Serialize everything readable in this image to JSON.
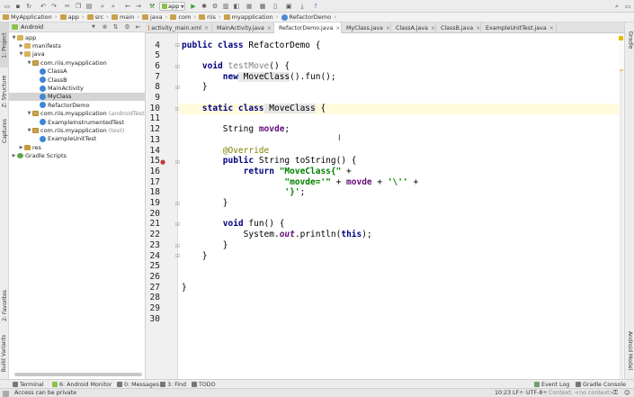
{
  "toolbar": {
    "run_config": "app",
    "icons": [
      "open-icon",
      "save-icon",
      "sync-icon",
      "undo-icon",
      "redo-icon",
      "cut-icon",
      "copy-icon",
      "paste-icon",
      "find-icon",
      "replace-icon",
      "back-icon",
      "forward-icon",
      "build-icon",
      "run-icon",
      "debug-icon",
      "attach-icon",
      "stop-icon",
      "sdk-icon",
      "avd-icon",
      "help-icon",
      "search-icon"
    ]
  },
  "breadcrumb": [
    "MyApplication",
    "app",
    "src",
    "main",
    "java",
    "com",
    "riis",
    "myapplication",
    "RefactorDemo"
  ],
  "left_tabs": {
    "project": "1: Project",
    "structure": "Z: Structure",
    "captures": "Captures",
    "favorites": "2: Favorites",
    "build_variants": "Build Variants"
  },
  "right_tabs": {
    "gradle": "Gradle",
    "android_model": "Android Model"
  },
  "project": {
    "view": "Android",
    "tree": [
      {
        "label": "app",
        "muted": ""
      },
      {
        "label": "manifests",
        "muted": ""
      },
      {
        "label": "java",
        "muted": ""
      },
      {
        "label": "com.riis.myapplication",
        "muted": ""
      },
      {
        "label": "ClassA",
        "muted": ""
      },
      {
        "label": "ClassB",
        "muted": ""
      },
      {
        "label": "MainActivity",
        "muted": ""
      },
      {
        "label": "MyClass",
        "muted": ""
      },
      {
        "label": "RefactorDemo",
        "muted": ""
      },
      {
        "label": "com.riis.myapplication",
        "muted": "(androidTest"
      },
      {
        "label": "ExampleInstrumentedTest",
        "muted": ""
      },
      {
        "label": "com.riis.myapplication",
        "muted": "(test)"
      },
      {
        "label": "ExampleUnitTest",
        "muted": ""
      },
      {
        "label": "res",
        "muted": ""
      },
      {
        "label": "Gradle Scripts",
        "muted": ""
      }
    ]
  },
  "tabs": [
    "activity_main.xml",
    "MainActivity.java",
    "RefactorDemo.java",
    "MyClass.java",
    "ClassA.java",
    "ClassB.java",
    "ExampleUnitTest.java"
  ],
  "line_numbers": [
    "4",
    "5",
    "6",
    "7",
    "8",
    "9",
    "10",
    "11",
    "12",
    "13",
    "14",
    "15",
    "16",
    "17",
    "18",
    "19",
    "20",
    "21",
    "22",
    "23",
    "24",
    "25",
    "26",
    "27",
    "28",
    "29",
    "30"
  ],
  "code": {
    "l4a": "public class",
    "l4b": " RefactorDemo {",
    "l6a": "void",
    "l6b": " testMove",
    "l6c": "() {",
    "l7a": "new",
    "l7b": " MoveClass",
    "l7c": "().fun();",
    "l8": "}",
    "l10a": "static class",
    "l10b": " MoveClass",
    "l10c": " {",
    "l12a": "String ",
    "l12b": "movde",
    "l12c": ";",
    "l14": "@Override",
    "l15a": "public",
    "l15b": " String toString() {",
    "l16a": "return",
    "l16b": " \"MoveClass{\"",
    "l16c": " +",
    "l17a": "\"movde='\"",
    "l17b": " + ",
    "l17c": "movde",
    "l17d": " + ",
    "l17e": "'\\''",
    "l17f": " +",
    "l18a": "'}'",
    "l18b": ";",
    "l19": "}",
    "l21a": "void",
    "l21b": " fun() {",
    "l22a": "System.",
    "l22b": "out",
    "l22c": ".println(",
    "l22d": "this",
    "l22e": ");",
    "l23": "}",
    "l24": "}",
    "l27": "}"
  },
  "bottom_tabs": [
    "Terminal",
    "6: Android Monitor",
    "0: Messages",
    "3: Find",
    "TODO",
    "Event Log",
    "Gradle Console"
  ],
  "status": {
    "message": "Access can be private",
    "position": "10:23",
    "line_sep": "LF÷",
    "encoding": "UTF-8÷",
    "context": "Context: <no context>"
  }
}
